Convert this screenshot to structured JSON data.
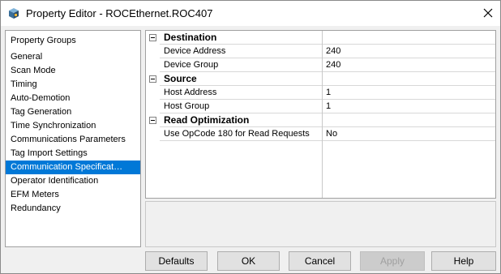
{
  "window": {
    "title": "Property Editor - ROCEthernet.ROC407"
  },
  "groups": {
    "header": "Property Groups",
    "items": [
      {
        "label": "General"
      },
      {
        "label": "Scan Mode"
      },
      {
        "label": "Timing"
      },
      {
        "label": "Auto-Demotion"
      },
      {
        "label": "Tag Generation"
      },
      {
        "label": "Time Synchronization"
      },
      {
        "label": "Communications Parameters"
      },
      {
        "label": "Tag Import Settings"
      },
      {
        "label": "Communication Specificat…",
        "selected": true
      },
      {
        "label": "Operator Identification"
      },
      {
        "label": "EFM Meters"
      },
      {
        "label": "Redundancy"
      }
    ]
  },
  "properties": {
    "categories": [
      {
        "name": "Destination",
        "rows": [
          {
            "name": "Device Address",
            "value": "240"
          },
          {
            "name": "Device Group",
            "value": "240"
          }
        ]
      },
      {
        "name": "Source",
        "rows": [
          {
            "name": "Host Address",
            "value": "1"
          },
          {
            "name": "Host Group",
            "value": "1"
          }
        ]
      },
      {
        "name": "Read Optimization",
        "rows": [
          {
            "name": "Use OpCode 180 for Read Requests",
            "value": "No"
          }
        ]
      }
    ]
  },
  "buttons": {
    "defaults": "Defaults",
    "ok": "OK",
    "cancel": "Cancel",
    "apply": "Apply",
    "help": "Help"
  },
  "colors": {
    "selection": "#0078d7",
    "disabled_text": "#a0a0a0"
  },
  "icons": {
    "app": "property-editor-icon",
    "close": "close-icon",
    "expander": "collapse-icon"
  }
}
